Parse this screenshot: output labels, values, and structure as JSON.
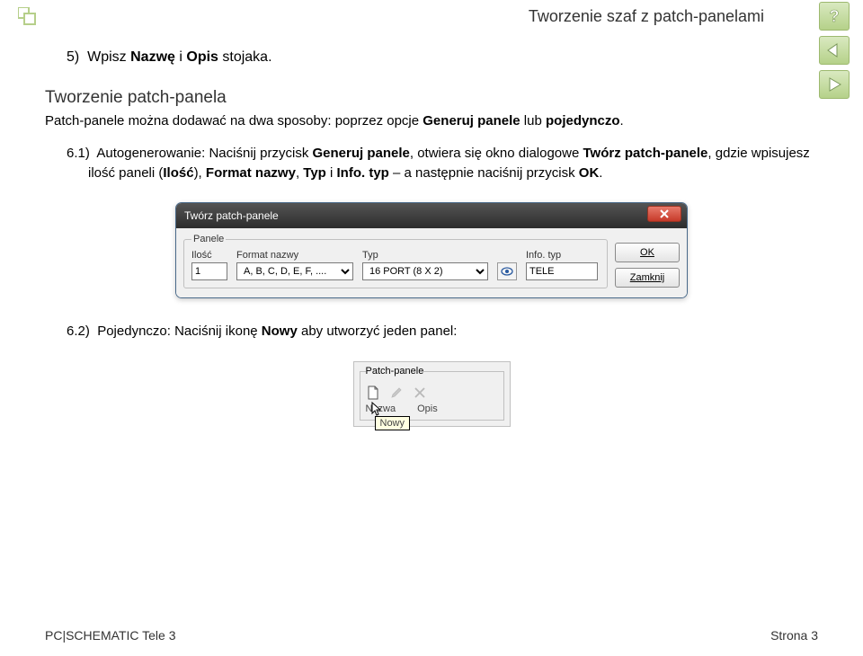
{
  "header": {
    "breadcrumb": "Tworzenie szaf z patch-panelami"
  },
  "step5": {
    "num": "5)",
    "prefix": "Wpisz ",
    "b1": "Nazwę",
    "mid": " i ",
    "b2": "Opis",
    "suffix": " stojaka."
  },
  "section": {
    "title": "Tworzenie patch-panela",
    "intro_pre": "Patch-panele można dodawać na dwa sposoby: poprzez opcje ",
    "intro_b1": "Generuj panele",
    "intro_mid": " lub ",
    "intro_b2": "pojedynczo",
    "intro_end": "."
  },
  "step61": {
    "num": "6.1)",
    "t1": "Autogenerowanie: Naciśnij przycisk ",
    "b1": "Generuj panele",
    "t2": ", otwiera się okno dialogowe ",
    "b2": "Twórz patch-panele",
    "t3": ", gdzie wpisujesz ilość paneli (",
    "b3": "Ilość",
    "t4": "), ",
    "b4": "Format nazwy",
    "t5": ", ",
    "b5": "Typ",
    "t6": " i ",
    "b6": "Info. typ",
    "t7": " – a następnie naciśnij przycisk ",
    "b7": "OK",
    "t8": "."
  },
  "dialog1": {
    "title": "Twórz patch-panele",
    "legend": "Panele",
    "ilosc_label": "Ilość",
    "ilosc_value": "1",
    "format_label": "Format nazwy",
    "format_value": "A, B, C, D, E, F, ....",
    "typ_label": "Typ",
    "typ_value": "16 PORT (8 X 2)",
    "info_label": "Info. typ",
    "info_value": "TELE",
    "ok": "OK",
    "close": "Zamknij"
  },
  "step62": {
    "num": "6.2)",
    "t1": "Pojedynczo: Naciśnij ikonę ",
    "b1": "Nowy",
    "t2": " aby utworzyć jeden panel:"
  },
  "snippet2": {
    "legend": "Patch-panele",
    "col1": "Nazwa",
    "col2": "Opis",
    "tooltip": "Nowy"
  },
  "footer": {
    "left": "PC|SCHEMATIC Tele 3",
    "right": "Strona 3"
  }
}
